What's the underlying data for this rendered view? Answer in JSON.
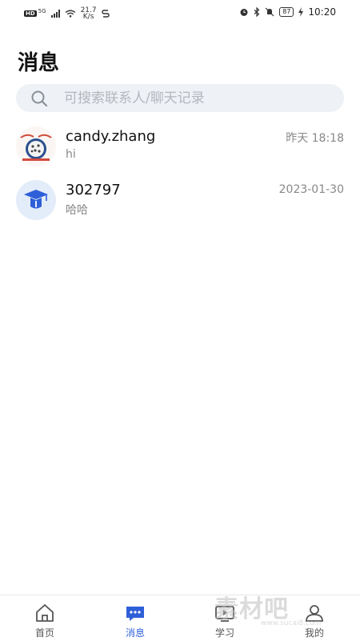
{
  "status_bar": {
    "network_badge": "HD",
    "network_type": "5G",
    "speed": "21.7",
    "speed_unit": "K/s",
    "battery": "87",
    "time": "10:20"
  },
  "page": {
    "title": "消息"
  },
  "search": {
    "placeholder": "可搜索联系人/聊天记录"
  },
  "conversations": [
    {
      "name": "candy.zhang",
      "last_message": "hi",
      "time": "昨天 18:18",
      "avatar": "cartoon-avatar-icon"
    },
    {
      "name": "302797",
      "last_message": "哈哈",
      "time": "2023-01-30",
      "avatar": "graduation-cap-icon"
    }
  ],
  "tabs": [
    {
      "label": "首页",
      "icon": "home-icon",
      "active": false
    },
    {
      "label": "消息",
      "icon": "chat-icon",
      "active": true
    },
    {
      "label": "学习",
      "icon": "study-icon",
      "active": false
    },
    {
      "label": "我的",
      "icon": "user-icon",
      "active": false
    }
  ],
  "watermark": {
    "text": "素材吧",
    "sub": "www.sucai8.com"
  },
  "colors": {
    "accent": "#2f5fd8",
    "search_bg": "#eef1f5",
    "muted": "#888888"
  }
}
